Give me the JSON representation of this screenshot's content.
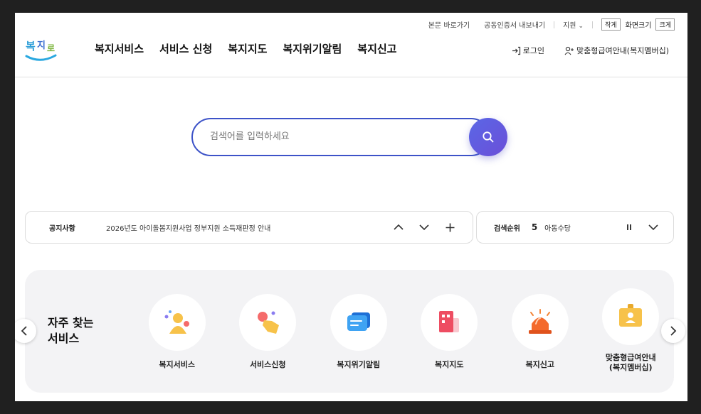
{
  "util": {
    "skip_link": "본문 바로가기",
    "cert_export": "공동인증서 내보내기",
    "support": "지원",
    "size_small": "작게",
    "size_label": "화면크기",
    "size_large": "크게"
  },
  "logo": {
    "text": "복지로"
  },
  "gnb": [
    "복지서비스",
    "서비스 신청",
    "복지지도",
    "복지위기알림",
    "복지신고"
  ],
  "header_right": {
    "login": "로그인",
    "membership": "맞춤형급여안내(복지멤버십)"
  },
  "search": {
    "placeholder": "검색어를 입력하세요"
  },
  "notice": {
    "title": "공지사항",
    "text": "2026년도 아이돌봄지원사업 정부지원 소득재판정 안내"
  },
  "rank": {
    "title": "검색순위",
    "number": "5",
    "keyword": "아동수당"
  },
  "services": {
    "title": "자주 찾는\n서비스",
    "items": [
      {
        "label": "복지서비스",
        "icon": "people-icon"
      },
      {
        "label": "서비스신청",
        "icon": "hand-click-icon"
      },
      {
        "label": "복지위기알림",
        "icon": "message-icon"
      },
      {
        "label": "복지지도",
        "icon": "building-icon"
      },
      {
        "label": "복지신고",
        "icon": "siren-icon"
      },
      {
        "label": "맞춤형급여안내\n(복지멤버십)",
        "icon": "id-card-icon"
      }
    ]
  },
  "colors": {
    "accent": "#3d53c8",
    "search_button": "#5a67e6",
    "panel_bg": "#f3f3f5"
  }
}
